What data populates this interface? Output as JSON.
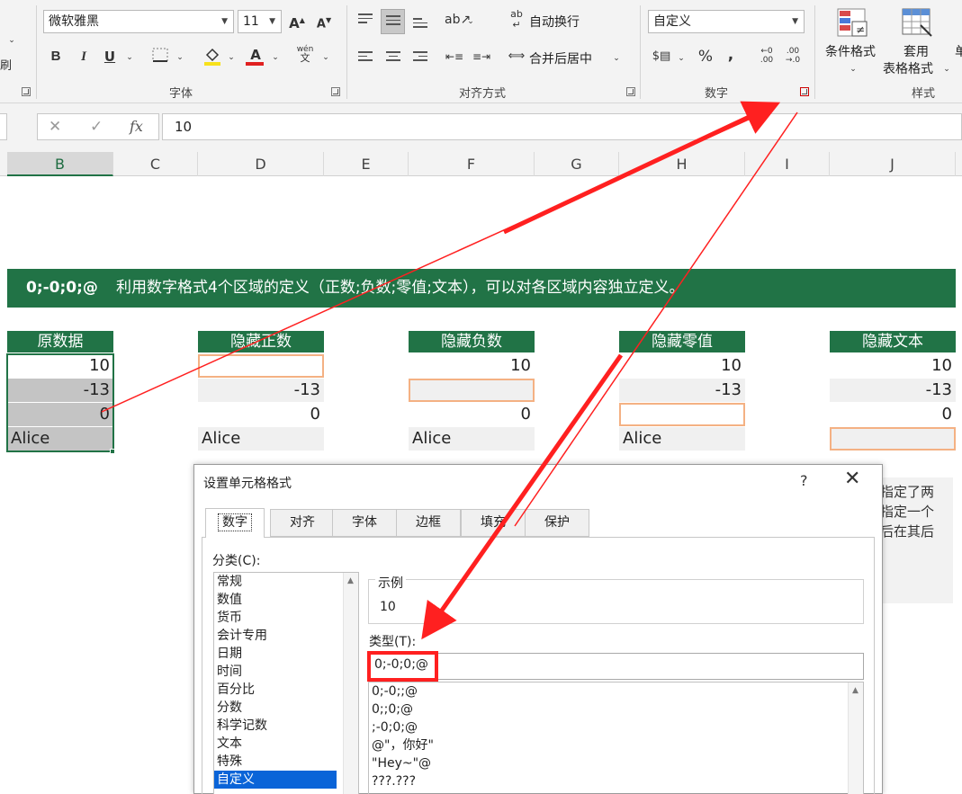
{
  "ribbon": {
    "font_name": "微软雅黑",
    "font_size": "11",
    "wrap_text": "自动换行",
    "merge_center": "合并后居中",
    "number_format": "自定义",
    "bold": "B",
    "italic": "I",
    "underline": "U",
    "grow_font": "A",
    "shrink_font": "A",
    "font_color": "A",
    "phonetic": "wén",
    "phonetic_char": "文",
    "percent": "%",
    "comma": ",",
    "inc_decimal_top": "←0",
    "inc_decimal_bottom": ".00",
    "dec_decimal_top": ".00",
    "dec_decimal_bottom": "→.0",
    "cond_format": "条件格式",
    "table_format_1": "套用",
    "table_format_2": "表格格式",
    "cell_style_partial": "单",
    "left_edge_text": "刷",
    "groups": {
      "font": "字体",
      "alignment": "对齐方式",
      "number": "数字",
      "styles": "样式"
    }
  },
  "formula_bar": {
    "cancel": "✕",
    "enter": "✓",
    "fx": "fx",
    "value": "10"
  },
  "columns": [
    "B",
    "C",
    "D",
    "E",
    "F",
    "G",
    "H",
    "I",
    "J"
  ],
  "banner": {
    "code": "0;-0;0;@",
    "desc": "利用数字格式4个区域的定义（正数;负数;零值;文本），可以对各区域内容独立定义。"
  },
  "tables": [
    {
      "header": "原数据",
      "values": [
        "10",
        "-13",
        "0",
        "Alice"
      ]
    },
    {
      "header": "隐藏正数",
      "values": [
        "",
        "-13",
        "0",
        "Alice"
      ]
    },
    {
      "header": "隐藏负数",
      "values": [
        "10",
        "",
        "0",
        "Alice"
      ]
    },
    {
      "header": "隐藏零值",
      "values": [
        "10",
        "-13",
        "",
        "Alice"
      ]
    },
    {
      "header": "隐藏文本",
      "values": [
        "10",
        "-13",
        "0",
        ""
      ]
    }
  ],
  "side_note": [
    "指定了两",
    "指定一个",
    "后在其后"
  ],
  "dialog": {
    "title": "设置单元格格式",
    "help": "?",
    "close": "✕",
    "tabs": [
      "数字",
      "对齐",
      "字体",
      "边框",
      "填充",
      "保护"
    ],
    "category_label": "分类(C):",
    "categories": [
      "常规",
      "数值",
      "货币",
      "会计专用",
      "日期",
      "时间",
      "百分比",
      "分数",
      "科学记数",
      "文本",
      "特殊",
      "自定义"
    ],
    "selected_category": "自定义",
    "sample_label": "示例",
    "sample_value": "10",
    "type_label": "类型(T):",
    "type_value": "0;-0;0;@",
    "format_list": [
      "0;-0;;@",
      "0;;0;@",
      ";-0;0;@",
      "@\"，你好\"",
      "\"Hey~\"@",
      "???.???"
    ]
  },
  "colors": {
    "accent_green": "#217346",
    "highlight_red": "#ff2020",
    "hidden_cell_border": "#f4b183",
    "selection_blue": "#0a64d8"
  }
}
